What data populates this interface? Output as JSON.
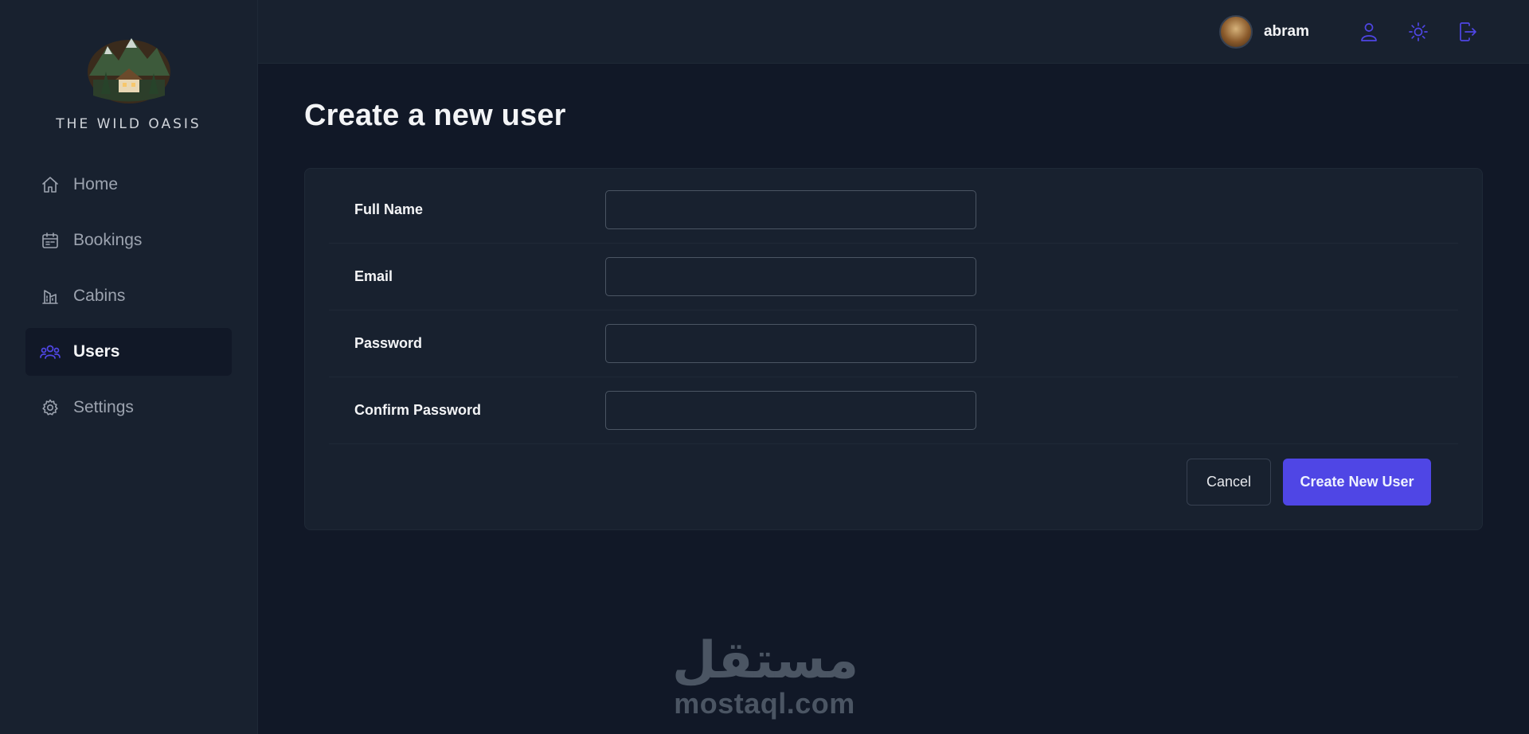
{
  "brand": {
    "name": "THE WILD OASIS"
  },
  "sidebar": {
    "items": [
      {
        "label": "Home",
        "icon": "home-icon",
        "active": false
      },
      {
        "label": "Bookings",
        "icon": "calendar-icon",
        "active": false
      },
      {
        "label": "Cabins",
        "icon": "building-icon",
        "active": false
      },
      {
        "label": "Users",
        "icon": "users-icon",
        "active": true
      },
      {
        "label": "Settings",
        "icon": "gear-icon",
        "active": false
      }
    ]
  },
  "header": {
    "username": "abram",
    "buttons": [
      "user-icon",
      "sun-icon",
      "logout-icon"
    ]
  },
  "main": {
    "title": "Create a new user",
    "form": {
      "fields": [
        {
          "label": "Full Name",
          "value": "",
          "placeholder": ""
        },
        {
          "label": "Email",
          "value": "",
          "placeholder": ""
        },
        {
          "label": "Password",
          "value": "",
          "placeholder": ""
        },
        {
          "label": "Confirm Password",
          "value": "",
          "placeholder": ""
        }
      ],
      "cancel_label": "Cancel",
      "submit_label": "Create New User"
    }
  },
  "watermark": {
    "arabic": "مستقل",
    "latin": "mostaql.com"
  },
  "colors": {
    "accent": "#4f46e5",
    "background": "#111827",
    "surface": "#18212f",
    "border": "#1f2937"
  }
}
